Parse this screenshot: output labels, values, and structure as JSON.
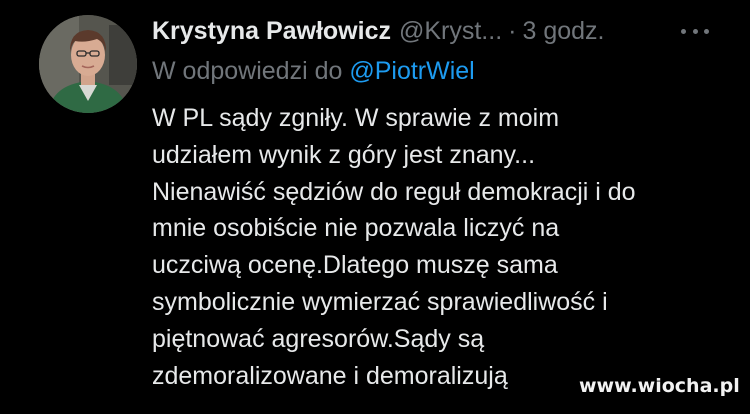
{
  "tweet": {
    "author_name": "Krystyna Pawłowicz",
    "author_handle": "@Kryst...",
    "separator": "·",
    "timestamp": "3 godz.",
    "reply_prefix": "W odpowiedzi do",
    "reply_to_handle": "@PiotrWiel",
    "text_lines": [
      "W PL sądy zgniły. W sprawie z moim",
      "udziałem wynik z góry jest znany...",
      "Nienawiść sędziów do reguł demokracji i do",
      "mnie osobiście nie pozwala liczyć na",
      "uczciwą ocenę.Dlatego muszę sama",
      "symbolicznie wymierzać sprawiedliwość i",
      "piętnować agresorów.Sądy są",
      "zdemoralizowane i demoralizują"
    ]
  },
  "icons": {
    "more": "more-options-icon",
    "avatar": "profile-avatar"
  },
  "watermark": {
    "text": "www.wiocha.pl"
  },
  "colors": {
    "background": "#000000",
    "primary_text": "#e7e9ea",
    "secondary_text": "#71767b",
    "link": "#1d9bf0"
  }
}
